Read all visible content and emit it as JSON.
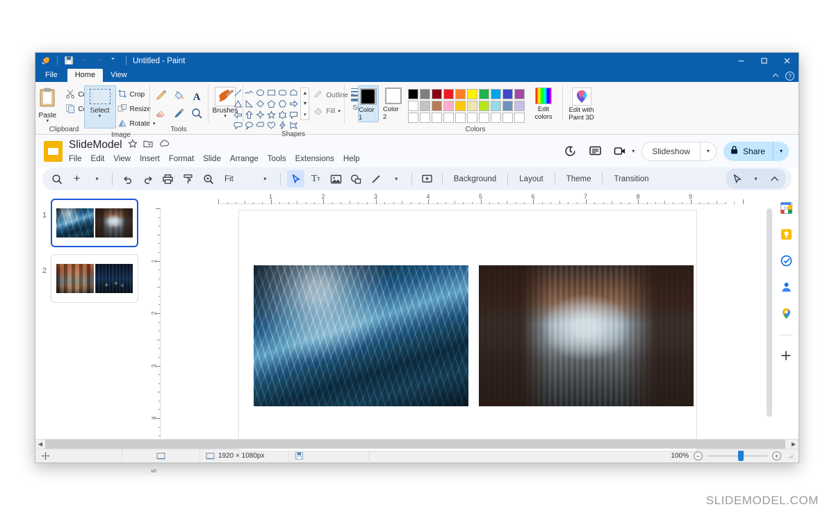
{
  "paint": {
    "title": "Untitled - Paint",
    "quick_access": [
      "paint-icon",
      "save-icon",
      "undo-icon",
      "redo-icon",
      "customize-caret"
    ],
    "window_controls": {
      "minimize": "minimize-icon",
      "maximize": "maximize-icon",
      "close": "close-icon"
    },
    "tabs": [
      {
        "label": "File",
        "active": false
      },
      {
        "label": "Home",
        "active": true
      },
      {
        "label": "View",
        "active": false
      }
    ],
    "ribbon_right": [
      "collapse-ribbon-caret",
      "help-icon"
    ],
    "groups": {
      "clipboard": {
        "label": "Clipboard",
        "paste": "Paste",
        "cut": "Cut",
        "copy": "Copy"
      },
      "image": {
        "label": "Image",
        "select": "Select",
        "crop": "Crop",
        "resize": "Resize",
        "rotate": "Rotate"
      },
      "tools": {
        "label": "Tools",
        "items": [
          "pencil-icon",
          "fill-bucket-icon",
          "text-icon",
          "eraser-icon",
          "color-picker-icon",
          "magnifier-icon"
        ]
      },
      "brushes": {
        "label": "Brushes"
      },
      "shapes": {
        "label": "Shapes",
        "outline": "Outline",
        "fill": "Fill"
      },
      "size": {
        "label": "Size"
      },
      "colors": {
        "label": "Colors",
        "color1": "Color 1",
        "color2": "Color 2",
        "color1_value": "#000000",
        "color2_value": "#ffffff",
        "edit_colors": "Edit colors",
        "paint3d": "Edit with Paint 3D",
        "palette_row1": [
          "#000000",
          "#7f7f7f",
          "#880015",
          "#ed1c24",
          "#ff7f27",
          "#fff200",
          "#22b14c",
          "#00a2e8",
          "#3f48cc",
          "#a349a4"
        ],
        "palette_row2": [
          "#ffffff",
          "#c3c3c3",
          "#b97a57",
          "#ffaec9",
          "#ffc90e",
          "#efe4b0",
          "#b5e61d",
          "#99d9ea",
          "#7092be",
          "#c8bfe7"
        ],
        "palette_row3": [
          "#ffffff",
          "#ffffff",
          "#ffffff",
          "#ffffff",
          "#ffffff",
          "#ffffff",
          "#ffffff",
          "#ffffff",
          "#ffffff",
          "#ffffff"
        ]
      }
    },
    "statusbar": {
      "position_icon": "move-cursor-icon",
      "selection_icon": "selection-size-icon",
      "canvas_icon": "canvas-size-icon",
      "canvas_size": "1920 × 1080px",
      "save_icon": "file-size-icon",
      "zoom_level": "100%",
      "zoom_out": "−",
      "zoom_in": "+"
    }
  },
  "slides": {
    "doc_title": "SlideModel",
    "title_icons": [
      "star-icon",
      "move-to-folder-icon",
      "cloud-saved-icon"
    ],
    "menus": [
      "File",
      "Edit",
      "View",
      "Insert",
      "Format",
      "Slide",
      "Arrange",
      "Tools",
      "Extensions",
      "Help"
    ],
    "header_actions": {
      "history_icon": "version-history-icon",
      "comment_icon": "comment-icon",
      "meet_icon": "meet-camera-icon",
      "meet_caret": "chevron-down-icon",
      "slideshow_label": "Slideshow",
      "slideshow_caret": "chevron-down-icon",
      "share_label": "Share",
      "share_lock_icon": "lock-icon",
      "share_caret": "chevron-down-icon"
    },
    "toolbar": {
      "search": "search-icon",
      "add": "+",
      "add_caret": "chevron-down-icon",
      "undo": "undo-icon",
      "redo": "redo-icon",
      "print": "print-icon",
      "paint_format": "paint-format-icon",
      "zoom": "zoom-icon",
      "fit_label": "Fit",
      "fit_caret": "chevron-down-icon",
      "select_tool": "cursor-icon",
      "textbox": "Tт",
      "image": "insert-image-icon",
      "shape": "shape-icon",
      "line": "line-icon",
      "line_caret": "chevron-down-icon",
      "comment": "add-comment-icon",
      "background": "Background",
      "layout": "Layout",
      "theme": "Theme",
      "transition": "Transition",
      "right_cursor": "cursor-icon",
      "right_caret": "chevron-down-icon",
      "collapse": "chevron-up-icon"
    },
    "filmstrip": [
      {
        "number": "1",
        "active": true,
        "images": [
          "skyscraper-glass",
          "old-street"
        ]
      },
      {
        "number": "2",
        "active": false,
        "images": [
          "warm-building",
          "night-city"
        ]
      }
    ],
    "ruler": {
      "h_labels": [
        "1",
        "2",
        "3",
        "4",
        "5",
        "6",
        "7",
        "8",
        "9"
      ],
      "v_labels": [
        "1",
        "2",
        "3",
        "4",
        "5"
      ]
    },
    "canvas": {
      "images": [
        "skyscraper-glass",
        "old-street"
      ]
    },
    "rail_icons": [
      "calendar-icon",
      "keep-icon",
      "tasks-icon",
      "contacts-icon",
      "maps-icon",
      "add-on-icon"
    ]
  },
  "watermark": "SLIDEMODEL.COM"
}
